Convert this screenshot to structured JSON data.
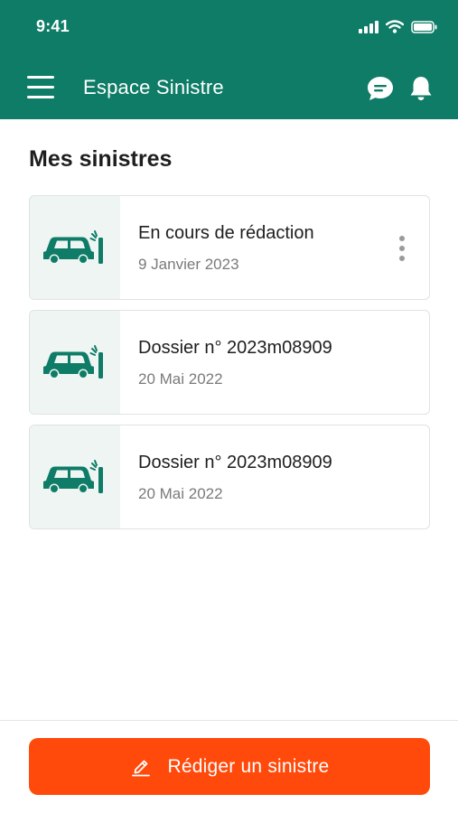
{
  "status_bar": {
    "time": "9:41",
    "icons": [
      "cellular-signal-icon",
      "wifi-icon",
      "battery-icon"
    ]
  },
  "app_bar": {
    "title": "Espace Sinistre",
    "left_icon": "menu-icon",
    "right_icons": [
      "chat-icon",
      "bell-icon"
    ],
    "background_color": "#0e7c66"
  },
  "main": {
    "section_title": "Mes sinistres",
    "claims": [
      {
        "title": "En cours de rédaction",
        "date": "9 Janvier 2023",
        "icon": "car-crash-icon",
        "has_menu": true
      },
      {
        "title": "Dossier n° 2023m08909",
        "date": "20 Mai 2022",
        "icon": "car-crash-icon",
        "has_menu": false
      },
      {
        "title": "Dossier n° 2023m08909",
        "date": "20 Mai 2022",
        "icon": "car-crash-icon",
        "has_menu": false
      }
    ]
  },
  "footer": {
    "cta_label": "Rédiger un sinistre",
    "cta_icon": "edit-pen-icon",
    "cta_color": "#ff4a0c"
  }
}
